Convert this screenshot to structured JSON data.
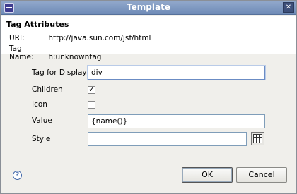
{
  "window": {
    "title": "Template"
  },
  "header": {
    "title": "Tag Attributes",
    "uri_label": "URI:",
    "uri_value": "http://java.sun.com/jsf/html",
    "tag_name_label": "Tag Name:",
    "tag_name_value": "h:unknowntag"
  },
  "form": {
    "tag_for_display": {
      "label": "Tag for Display",
      "value": "div"
    },
    "children": {
      "label": "Children",
      "checked": true
    },
    "icon": {
      "label": "Icon",
      "checked": false
    },
    "value": {
      "label": "Value",
      "value": "{name()}"
    },
    "style": {
      "label": "Style",
      "value": ""
    }
  },
  "buttons": {
    "ok": "OK",
    "cancel": "Cancel"
  },
  "icons": {
    "app": "app-icon",
    "close": "close-icon",
    "style_picker": "grid-icon",
    "help": "help-icon"
  },
  "colors": {
    "titlebar": "#7f99c2",
    "header_bg": "#ffffff",
    "dialog_bg": "#f0efeb"
  }
}
